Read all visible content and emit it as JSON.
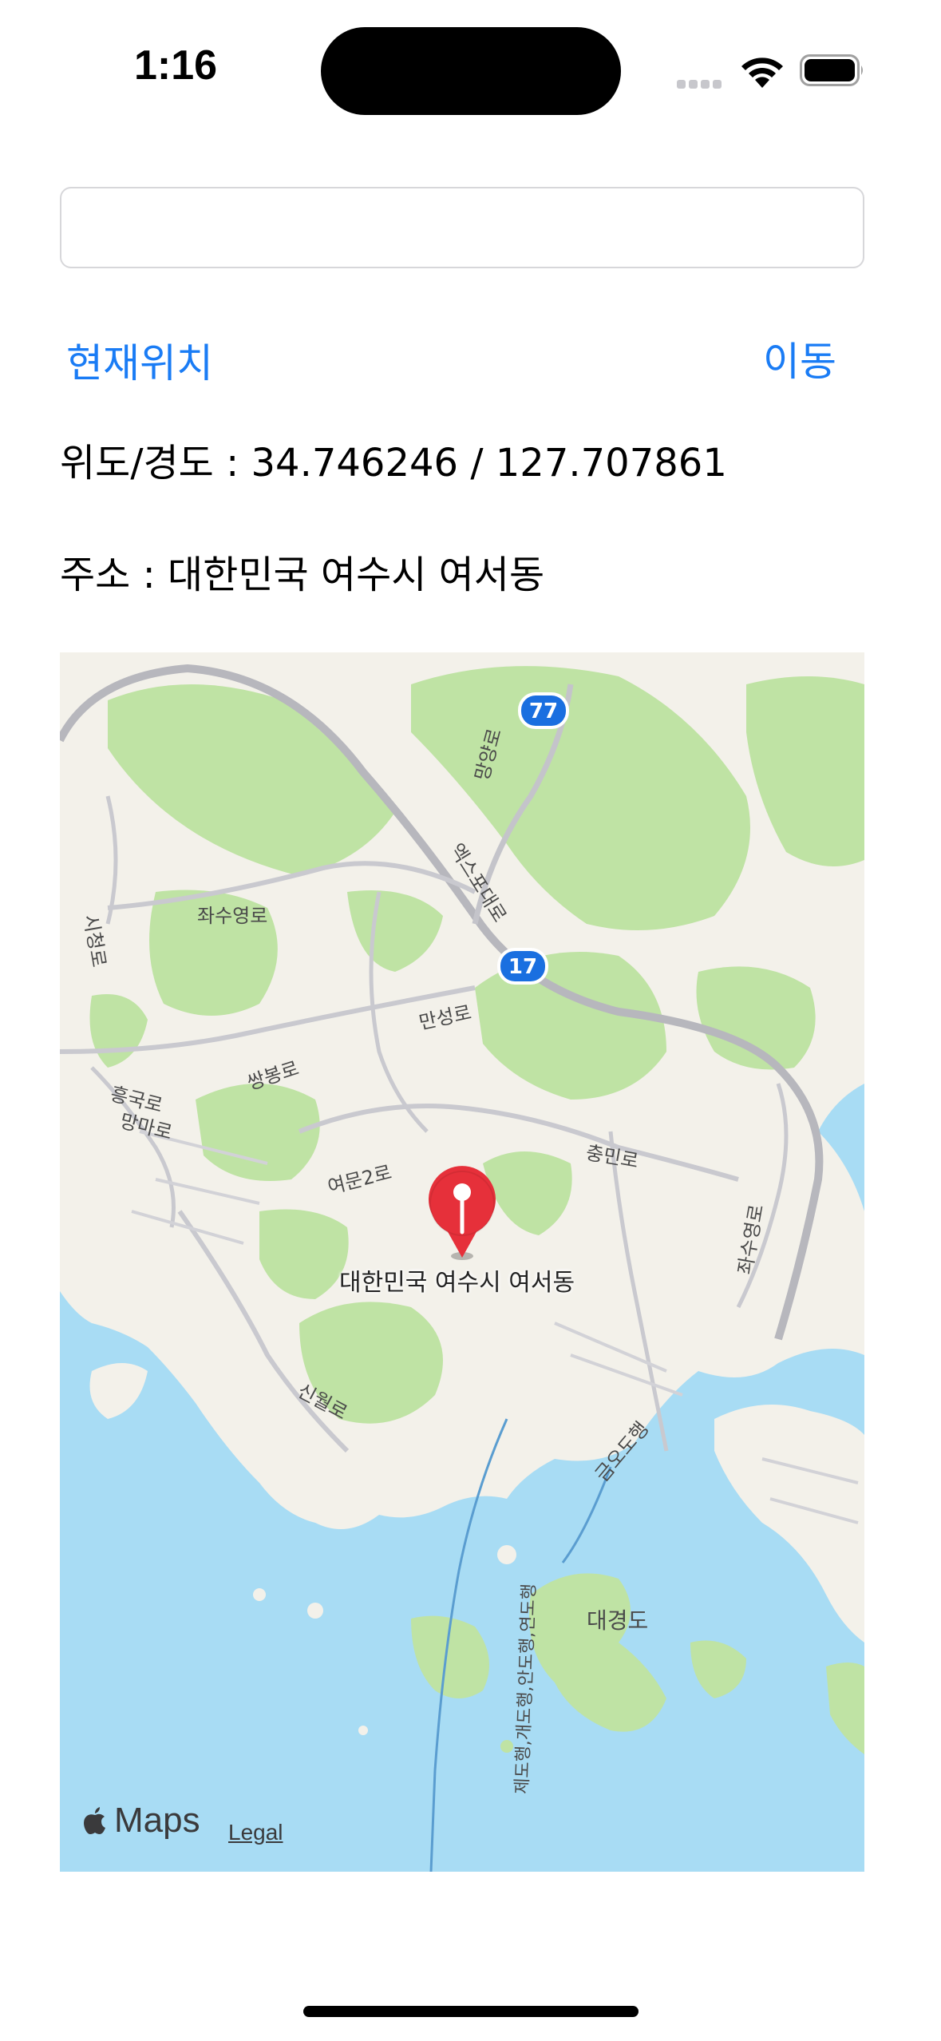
{
  "status_bar": {
    "time": "1:16",
    "icons": [
      "signal-icon",
      "wifi-icon",
      "battery-icon"
    ]
  },
  "search": {
    "value": "",
    "placeholder": ""
  },
  "actions": {
    "current_location_label": "현재위치",
    "move_label": "이동"
  },
  "location": {
    "coordinates_text": "위도/경도 : 34.746246 / 127.707861",
    "address_text": "주소 : 대한민국 여수시 여서동"
  },
  "map": {
    "pin_label": "대한민국 여수시 여서동",
    "route_shield_77": "77",
    "route_shield_17": "17",
    "roads": {
      "r1": "엑스포대로",
      "r2": "좌수영로",
      "r3": "시청로",
      "r4": "만성로",
      "r5": "쌍봉로",
      "r6": "흥국로",
      "r7": "망마로",
      "r8": "충민로",
      "r9": "여문2로",
      "r10": "신월로",
      "r11": "금오도행",
      "r12": "제도행,개도행,안도행,연도행",
      "r13": "망양로",
      "r14": "좌수영로"
    },
    "island_label": "대경도",
    "attribution": {
      "logo": "Maps",
      "legal": "Legal"
    },
    "colors": {
      "water": "#a8dcf4",
      "land": "#f3f1ea",
      "green": "#bfe3a4",
      "pin": "#e6303a",
      "shield": "#1a6fe0"
    }
  }
}
